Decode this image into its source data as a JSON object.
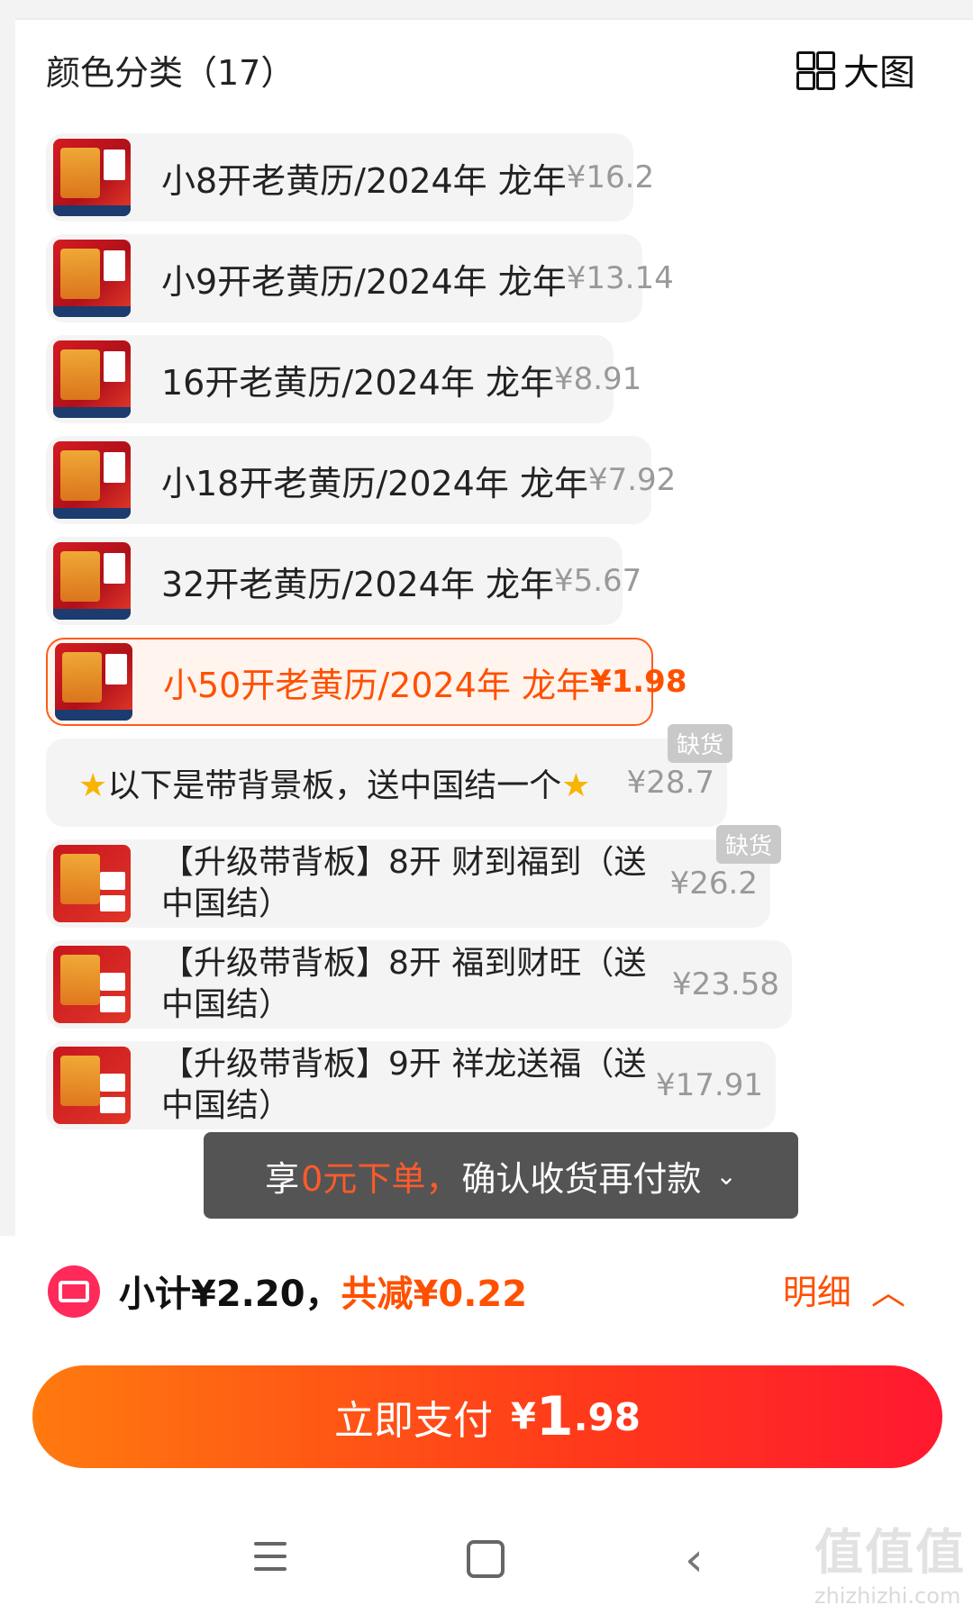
{
  "header": {
    "title": "颜色分类（17）",
    "bigview_label": "大图"
  },
  "options": [
    {
      "label": "小8开老黄历/2024年 龙年",
      "price": "¥16.2"
    },
    {
      "label": "小9开老黄历/2024年 龙年",
      "price": "¥13.14"
    },
    {
      "label": "16开老黄历/2024年 龙年",
      "price": "¥8.91"
    },
    {
      "label": "小18开老黄历/2024年 龙年",
      "price": "¥7.92"
    },
    {
      "label": "32开老黄历/2024年 龙年",
      "price": "¥5.67"
    },
    {
      "label": "小50开老黄历/2024年 龙年",
      "price": "¥1.98",
      "selected": true
    },
    {
      "label": "以下是带背景板，送中国结一个",
      "price": "¥28.7",
      "badge": "缺货"
    },
    {
      "label": "【升级带背板】8开 财到福到（送中国结）",
      "price": "¥26.2",
      "badge": "缺货"
    },
    {
      "label": "【升级带背板】8开 福到财旺（送中国结）",
      "price": "¥23.58"
    },
    {
      "label": "【升级带背板】9开 祥龙送福（送中国结）",
      "price": "¥17.91"
    }
  ],
  "toast": {
    "prefix": "享",
    "highlight": "0元下单，",
    "suffix": "确认收货再付款",
    "chevron": "⌄"
  },
  "summary": {
    "subtotal": "小计¥2.20，",
    "discount": "共减¥0.22",
    "detail_label": "明细",
    "detail_chevron": "︿"
  },
  "pay_button": {
    "label": "立即支付",
    "currency": "¥",
    "amount_int": "1",
    "amount_dec": ".98"
  },
  "nav": {
    "back_glyph": "‹"
  },
  "watermark": {
    "logo": "值值值",
    "domain": "zhizhizhi.com"
  },
  "colors": {
    "accent": "#ff5000",
    "selected_bg": "#fff4ee",
    "badge_bg": "#c9c9c9",
    "pay_gradient_start": "#ff7a0f",
    "pay_gradient_end": "#ff1830"
  },
  "icons": {
    "bigview": "grid-icon",
    "coupon": "coupon-icon",
    "nav_menu": "menu-icon",
    "nav_home": "home-icon",
    "nav_back": "back-icon",
    "star": "star-icon"
  }
}
